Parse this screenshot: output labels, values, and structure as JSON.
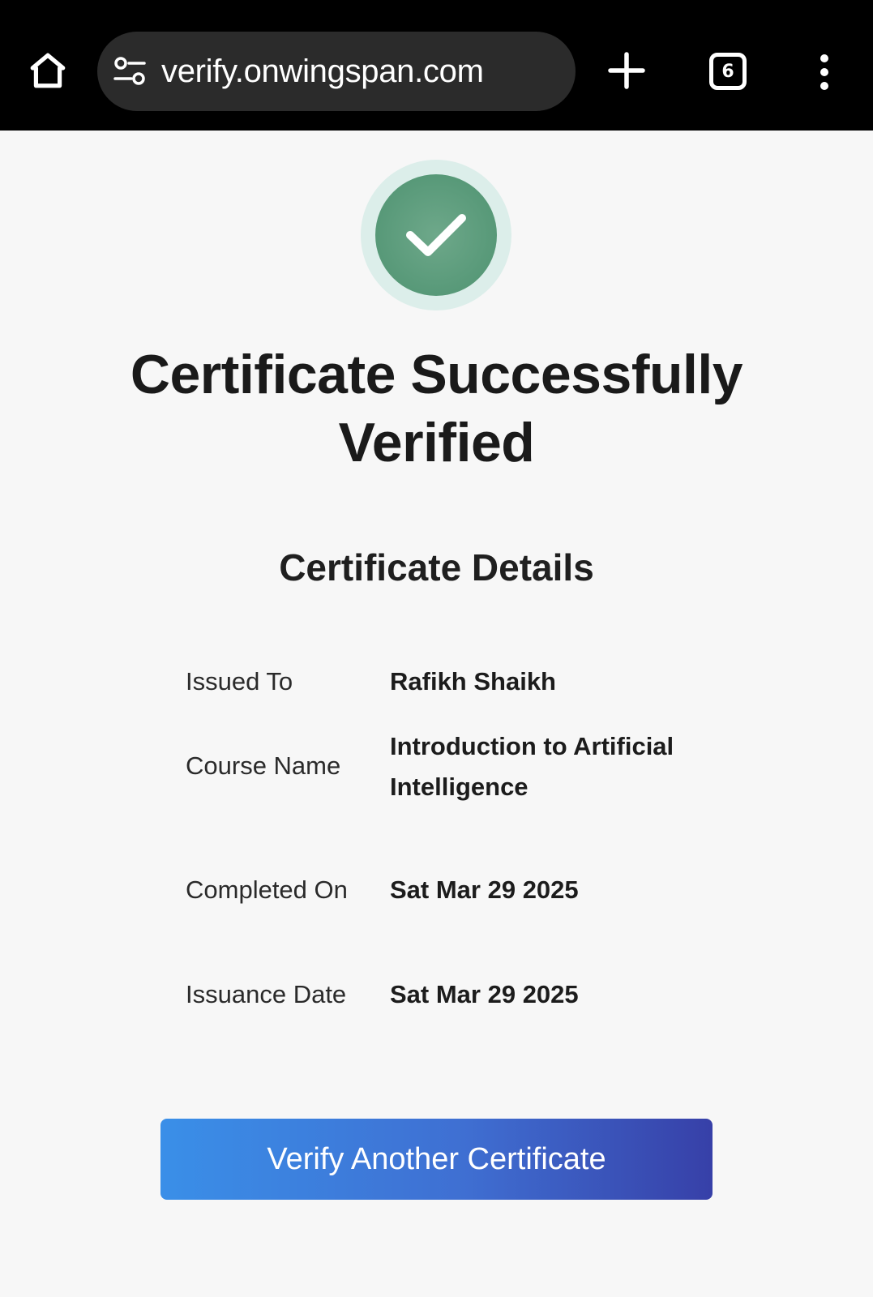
{
  "browser": {
    "url": "verify.onwingspan.com",
    "tab_count": "6",
    "icons": [
      "home-icon",
      "site-settings-icon",
      "plus-icon",
      "tab-switcher-icon",
      "more-vert-icon"
    ]
  },
  "status": {
    "icon": "check-icon",
    "color": "#5c9c7c",
    "title": "Certificate Successfully Verified"
  },
  "details": {
    "heading": "Certificate Details",
    "rows": [
      {
        "label": "Issued To",
        "value": "Rafikh Shaikh"
      },
      {
        "label": "Course Name",
        "value": "Introduction to Artificial Intelligence"
      },
      {
        "label": "Completed On",
        "value": "Sat Mar 29 2025"
      },
      {
        "label": "Issuance Date",
        "value": "Sat Mar 29 2025"
      }
    ]
  },
  "actions": {
    "verify_another_label": "Verify Another Certificate"
  }
}
